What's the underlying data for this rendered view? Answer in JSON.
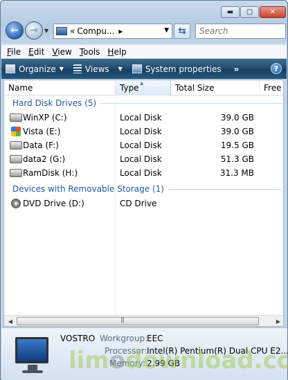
{
  "window": {
    "min_label": "▬",
    "max_label": "▢",
    "close_label": "✕"
  },
  "nav": {
    "address_text": "Compu...",
    "address_prefix": "«",
    "search_placeholder": "Search"
  },
  "menu": [
    "File",
    "Edit",
    "View",
    "Tools",
    "Help"
  ],
  "command_bar": {
    "organize": "Organize",
    "views": "Views",
    "system_properties": "System properties",
    "more": "»",
    "help": "?"
  },
  "columns": {
    "name": "Name",
    "type": "Type",
    "total_size": "Total Size",
    "free_space": "Free S"
  },
  "groups": [
    {
      "title": "Hard Disk Drives (5)",
      "items": [
        {
          "name": "WinXP (C:)",
          "type": "Local Disk",
          "size": "39.0 GB",
          "icon": "drive-icon"
        },
        {
          "name": "Vista (E:)",
          "type": "Local Disk",
          "size": "39.0 GB",
          "icon": "windows-drive-icon"
        },
        {
          "name": "Data (F:)",
          "type": "Local Disk",
          "size": "19.5 GB",
          "icon": "drive-icon"
        },
        {
          "name": "data2 (G:)",
          "type": "Local Disk",
          "size": "51.3 GB",
          "icon": "drive-icon"
        },
        {
          "name": "RamDisk (H:)",
          "type": "Local Disk",
          "size": "31.3 MB",
          "icon": "drive-icon"
        }
      ]
    },
    {
      "title": "Devices with Removable Storage (1)",
      "items": [
        {
          "name": "DVD Drive (D:)",
          "type": "CD Drive",
          "size": "",
          "icon": "dvd-icon"
        }
      ]
    }
  ],
  "details": {
    "computer_name": "VOSTRO",
    "workgroup_label": "Workgroup:",
    "workgroup_value": "EEC",
    "processor_label": "Processor:",
    "processor_value": "Intel(R) Pentium(R) Dual  CPU  E2...",
    "memory_label": "Memory:",
    "memory_value": "2.99 GB"
  },
  "watermark": {
    "a": "lim",
    "b": "o",
    "c": "download.com"
  }
}
